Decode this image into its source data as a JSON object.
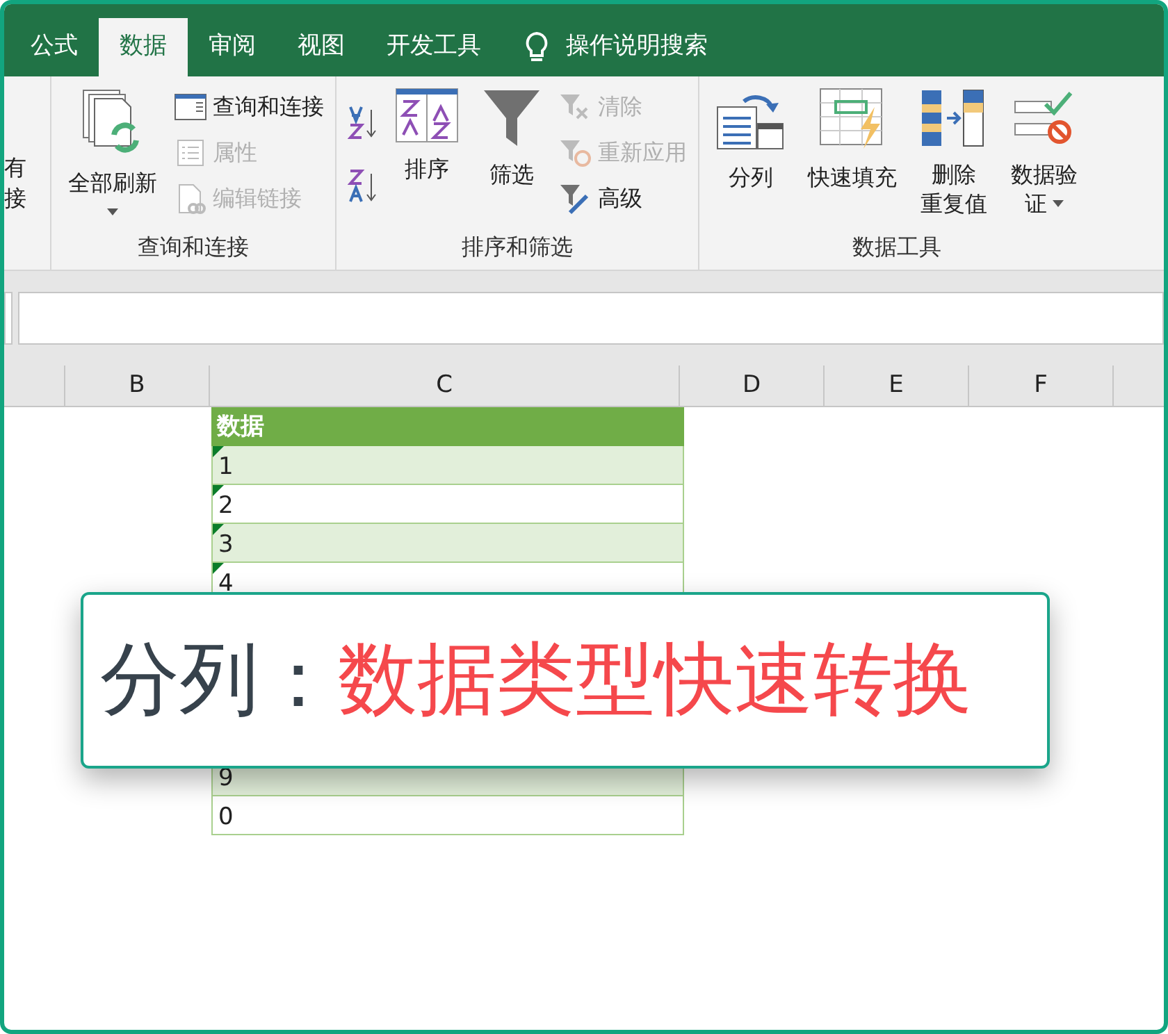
{
  "tabs": [
    {
      "label": "公式",
      "selected": false
    },
    {
      "label": "数据",
      "selected": true
    },
    {
      "label": "审阅",
      "selected": false
    },
    {
      "label": "视图",
      "selected": false
    },
    {
      "label": "开发工具",
      "selected": false
    }
  ],
  "tell_me": {
    "placeholder": "操作说明搜索"
  },
  "ribbon": {
    "cut_group_lines": [
      "有",
      "接"
    ],
    "groups": [
      {
        "kind": "queries",
        "title": "查询和连接",
        "large": [
          {
            "lines": [
              "全部刷新"
            ],
            "dropdown": true
          }
        ],
        "small": [
          {
            "label": "查询和连接",
            "disabled": false
          },
          {
            "label": "属性",
            "disabled": true
          },
          {
            "label": "编辑链接",
            "disabled": true
          }
        ]
      },
      {
        "kind": "sort",
        "title": "排序和筛选",
        "large": [
          {
            "lines": [
              "排序"
            ],
            "dropdown": false
          },
          {
            "lines": [
              "筛选"
            ],
            "dropdown": false
          }
        ],
        "small": [
          {
            "label": "清除",
            "disabled": true
          },
          {
            "label": "重新应用",
            "disabled": true
          },
          {
            "label": "高级",
            "disabled": false
          }
        ]
      },
      {
        "kind": "tools",
        "title": "数据工具",
        "large": [
          {
            "lines": [
              "分列"
            ],
            "dropdown": false
          },
          {
            "lines": [
              "快速填充"
            ],
            "dropdown": false
          },
          {
            "lines": [
              "删除",
              "重复值"
            ],
            "dropdown": false
          },
          {
            "lines": [
              "数据验",
              "证"
            ],
            "dropdown": true
          }
        ]
      }
    ]
  },
  "columns": [
    "B",
    "C",
    "D",
    "E",
    "F"
  ],
  "table": {
    "header": "数据",
    "rows": [
      {
        "value": "1",
        "flagged": true
      },
      {
        "value": "2",
        "flagged": true
      },
      {
        "value": "3",
        "flagged": true
      },
      {
        "value": "4",
        "flagged": true
      }
    ],
    "rows_below": [
      {
        "value": "9",
        "flagged": false
      },
      {
        "value": "0",
        "flagged": false
      }
    ]
  },
  "banner": {
    "label": "分列：",
    "highlight": "数据类型快速转换"
  }
}
